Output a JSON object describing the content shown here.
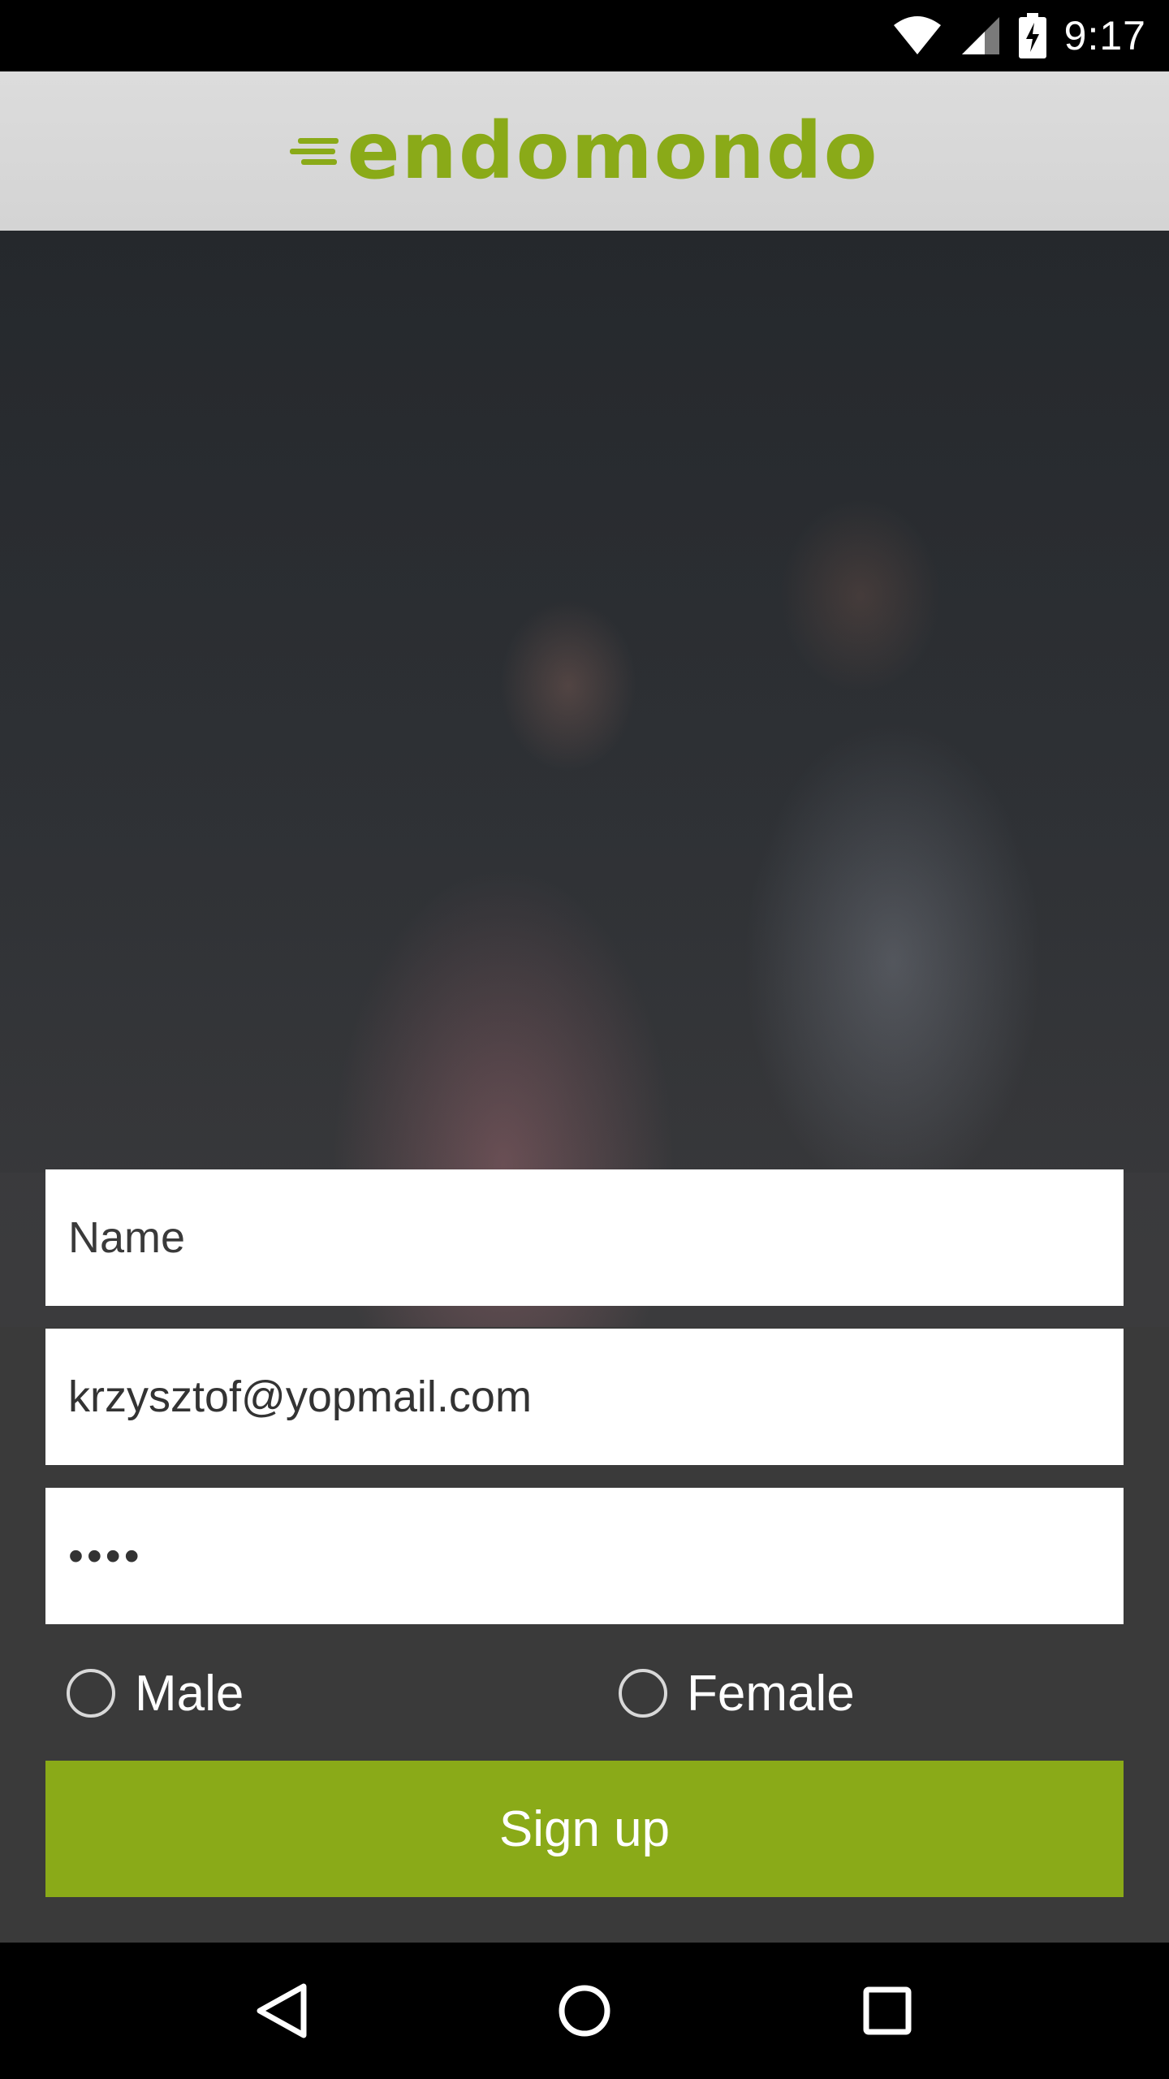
{
  "status_bar": {
    "time": "9:17",
    "icons": [
      "wifi-icon",
      "cellular-signal-icon",
      "battery-charging-icon"
    ]
  },
  "header": {
    "logo_text": "endomondo",
    "brand_color": "#8aaa18"
  },
  "form": {
    "name_placeholder": "Name",
    "email_value": "krzysztof@yopmail.com",
    "password_masked": "••••",
    "gender_options": [
      {
        "label": "Male",
        "selected": false
      },
      {
        "label": "Female",
        "selected": false
      }
    ],
    "signup_label": "Sign up"
  },
  "nav_bar": {
    "icons": [
      "back-icon",
      "home-icon",
      "recents-icon"
    ]
  }
}
